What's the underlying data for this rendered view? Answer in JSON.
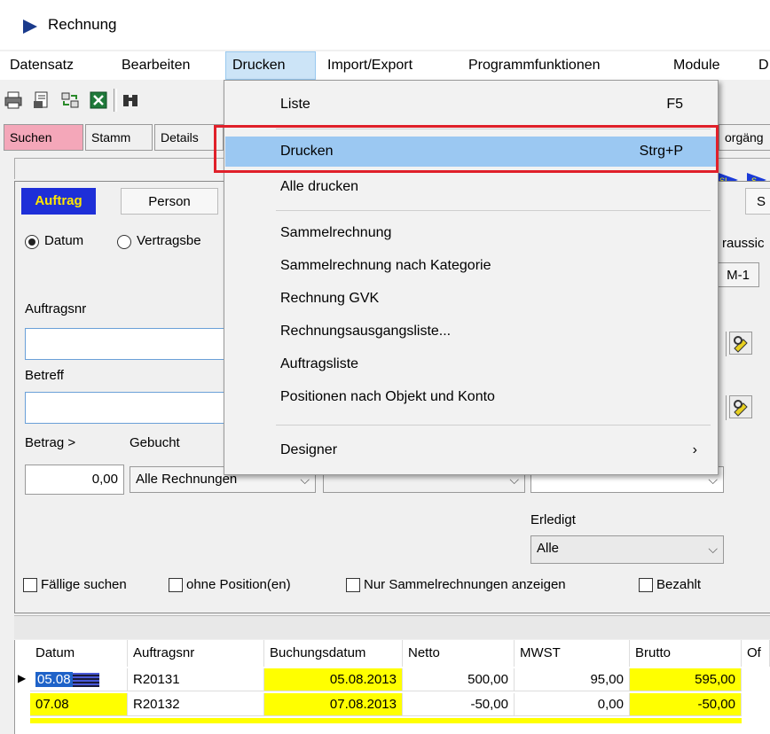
{
  "window": {
    "title": "Rechnung"
  },
  "menubar": {
    "items": [
      "Datensatz",
      "Bearbeiten",
      "Drucken",
      "Import/Export",
      "Programmfunktionen",
      "Module",
      "D"
    ]
  },
  "tabs_top": [
    "Suchen",
    "Stamm",
    "Details",
    "orgäng"
  ],
  "tabs_search": [
    "Auftrag",
    "Person",
    "S"
  ],
  "search": {
    "radio_datum": "Datum",
    "radio_vertrag": "Vertragsbe",
    "voraus_label": "raussic",
    "m1_button": "M-1",
    "auftragsnr_label": "Auftragsnr",
    "auftragsnr_value": "",
    "betreff_label": "Betreff",
    "betreff_value": "",
    "betrag_label": "Betrag >",
    "betrag_value": "0,00",
    "gebucht_label": "Gebucht",
    "gebucht_value": "Alle Rechnungen",
    "erledigt_label": "Erledigt",
    "erledigt_value": "Alle",
    "check_faellige": "Fällige suchen",
    "check_ohne_pos": "ohne Position(en)",
    "check_sammel": "Nur Sammelrechnungen anzeigen",
    "check_bezahlt": "Bezahlt"
  },
  "grid": {
    "columns": [
      "Datum",
      "Auftragsnr",
      "Buchungsdatum",
      "Netto",
      "MWST",
      "Brutto",
      "Of"
    ],
    "rows": [
      {
        "datum": "05.08",
        "auftragsnr": "R20131",
        "buchungsdatum": "05.08.2013",
        "netto": "500,00",
        "mwst": "95,00",
        "brutto": "595,00"
      },
      {
        "datum": "07.08",
        "auftragsnr": "R20132",
        "buchungsdatum": "07.08.2013",
        "netto": "-50,00",
        "mwst": "0,00",
        "brutto": "-50,00"
      }
    ]
  },
  "dropdown": {
    "items": [
      {
        "label": "Liste",
        "shortcut": "F5"
      },
      {
        "label": "Drucken",
        "shortcut": "Strg+P"
      },
      {
        "label": "Alle drucken",
        "shortcut": ""
      },
      {
        "label": "Sammelrechnung",
        "shortcut": ""
      },
      {
        "label": "Sammelrechnung nach Kategorie",
        "shortcut": ""
      },
      {
        "label": "Rechnung GVK",
        "shortcut": ""
      },
      {
        "label": "Rechnungsausgangsliste...",
        "shortcut": ""
      },
      {
        "label": "Auftragsliste",
        "shortcut": ""
      },
      {
        "label": "Positionen nach Objekt und Konto",
        "shortcut": ""
      },
      {
        "label": "Designer",
        "shortcut": "›"
      }
    ]
  },
  "colors": {
    "highlight": "#9bc8f2",
    "annotation_box": "#e0202a",
    "tab_active_bg": "#1e2fd8",
    "tab_active_fg": "#ffe600",
    "cell_yellow": "#ffff00",
    "suchen_tab": "#f4a7b9"
  }
}
